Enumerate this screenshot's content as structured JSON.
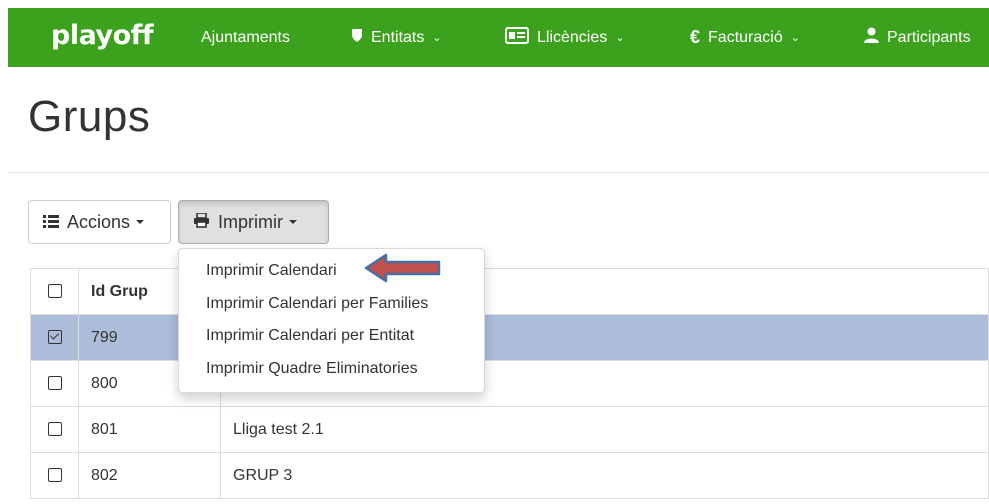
{
  "navbar": {
    "brand": "playoff",
    "items": [
      {
        "label": "Ajuntaments",
        "icon": "",
        "dropdown": false
      },
      {
        "label": "Entitats",
        "icon": "shield-icon",
        "dropdown": true
      },
      {
        "label": "Llicències",
        "icon": "id-card-icon",
        "dropdown": true
      },
      {
        "label": "Facturació",
        "icon": "euro-icon",
        "dropdown": true
      },
      {
        "label": "Participants",
        "icon": "user-icon",
        "dropdown": false
      }
    ],
    "bg_color": "#3ca21e"
  },
  "page": {
    "title": "Grups"
  },
  "toolbar": {
    "actions_label": "Accions",
    "print_label": "Imprimir"
  },
  "print_menu": {
    "items": [
      "Imprimir Calendari",
      "Imprimir Calendari per Families",
      "Imprimir Calendari per Entitat",
      "Imprimir Quadre Eliminatories"
    ]
  },
  "table": {
    "columns": [
      "",
      "Id Grup",
      ""
    ],
    "rows": [
      {
        "id": "799",
        "name": "",
        "selected": true
      },
      {
        "id": "800",
        "name": "",
        "selected": false
      },
      {
        "id": "801",
        "name": "Lliga test 2.1",
        "selected": false
      },
      {
        "id": "802",
        "name": "GRUP 3",
        "selected": false
      }
    ],
    "selected_color": "#acbcd9"
  },
  "annotation": {
    "arrow_color": "#c0504d"
  }
}
